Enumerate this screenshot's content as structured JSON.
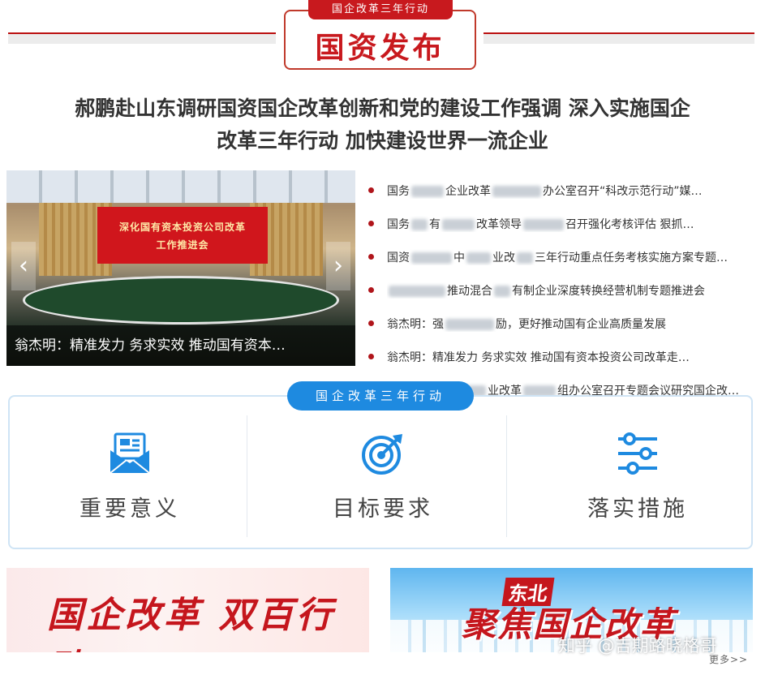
{
  "header": {
    "tab_label": "国企改革三年行动",
    "title": "国资发布"
  },
  "headline": {
    "line1": "郝鹏赴山东调研国资国企改革创新和党的建设工作强调 深入实施国企",
    "line2": "改革三年行动 加快建设世界一流企业"
  },
  "slider": {
    "banner_line1": "深化国有资本投资公司改革",
    "banner_line2": "工作推进会",
    "caption": "翁杰明：精准发力 务求实效 推动国有资本…",
    "prev_icon": "chevron-left-icon",
    "next_icon": "chevron-right-icon"
  },
  "news": [
    {
      "a": "国务",
      "b": "企业改革",
      "c": "办公室召开“科改示范行动”媒…"
    },
    {
      "a": "国务",
      "b": "有",
      "c": "改革领导",
      "d": "召开强化考核评估 狠抓…"
    },
    {
      "a": "国资",
      "b": "中",
      "c": "业改",
      "d": "三年行动重点任务考核实施方案专题…"
    },
    {
      "a": "",
      "b": "推动混合",
      "c": "有制企业深度转换经营机制专题推进会"
    },
    {
      "a": "翁杰明：强",
      "b": "励，更好推动国有企业高质量发展"
    },
    {
      "a": "翁杰明：精准发力 务求实效 推动国有资本投资公司改革走…"
    },
    {
      "a": "",
      "b": "业改革",
      "c": "组办公室召开专题会议研究国企改…"
    }
  ],
  "action": {
    "tab_label": "国企改革三年行动",
    "items": [
      {
        "label": "重要意义",
        "icon": "document-envelope-icon"
      },
      {
        "label": "目标要求",
        "icon": "target-icon"
      },
      {
        "label": "落实措施",
        "icon": "sliders-icon"
      }
    ]
  },
  "banners": {
    "left_text": "国企改革 双百行动",
    "right_small": "东北",
    "right_big": "聚焦国企改革"
  },
  "watermark": "知乎 @吉期路晓格哥",
  "more_label": "更多>>",
  "colors": {
    "brand_red": "#c8191e",
    "accent_blue": "#1e8ae0"
  }
}
